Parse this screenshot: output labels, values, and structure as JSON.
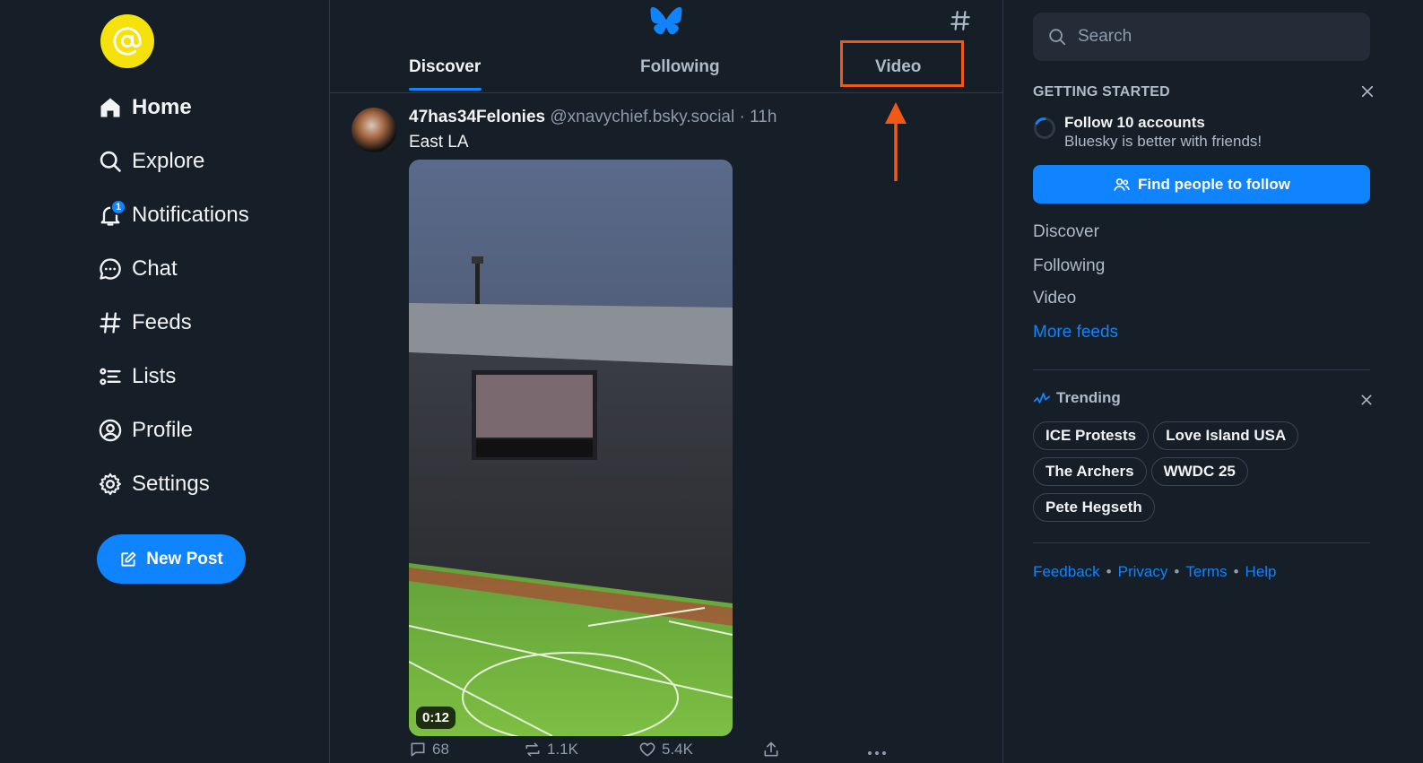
{
  "nav": {
    "items": [
      {
        "label": "Home",
        "icon": "home-icon"
      },
      {
        "label": "Explore",
        "icon": "search-icon"
      },
      {
        "label": "Notifications",
        "icon": "bell-icon",
        "badge": "1"
      },
      {
        "label": "Chat",
        "icon": "chat-bubble-icon"
      },
      {
        "label": "Feeds",
        "icon": "hash-icon"
      },
      {
        "label": "Lists",
        "icon": "list-icon"
      },
      {
        "label": "Profile",
        "icon": "user-circle-icon"
      },
      {
        "label": "Settings",
        "icon": "gear-icon"
      }
    ],
    "new_post_label": "New Post"
  },
  "feed": {
    "tabs": [
      "Discover",
      "Following",
      "Video"
    ],
    "active_tab": "Discover",
    "highlighted_tab": "Video"
  },
  "post": {
    "author": "47has34Felonies",
    "handle": "@xnavychief.bsky.social",
    "separator": "·",
    "time": "11h",
    "text": "East LA",
    "video_duration": "0:12",
    "replies": "68",
    "reposts": "1.1K",
    "likes": "5.4K"
  },
  "sidebar": {
    "search_placeholder": "Search",
    "getting_started": {
      "title": "GETTING STARTED",
      "task": "Follow 10 accounts",
      "subtitle": "Bluesky is better with friends!",
      "button": "Find people to follow"
    },
    "feeds": [
      "Discover",
      "Following",
      "Video"
    ],
    "more_feeds": "More feeds",
    "trending": {
      "title": "Trending",
      "topics": [
        "ICE Protests",
        "Love Island USA",
        "The Archers",
        "WWDC 25",
        "Pete Hegseth"
      ]
    },
    "footer": {
      "links": [
        "Feedback",
        "Privacy",
        "Terms",
        "Help"
      ],
      "separator": "•"
    }
  },
  "colors": {
    "background": "#161e27",
    "accent": "#1083fe",
    "logo": "#f5e10c",
    "annotation": "#f05a14"
  }
}
